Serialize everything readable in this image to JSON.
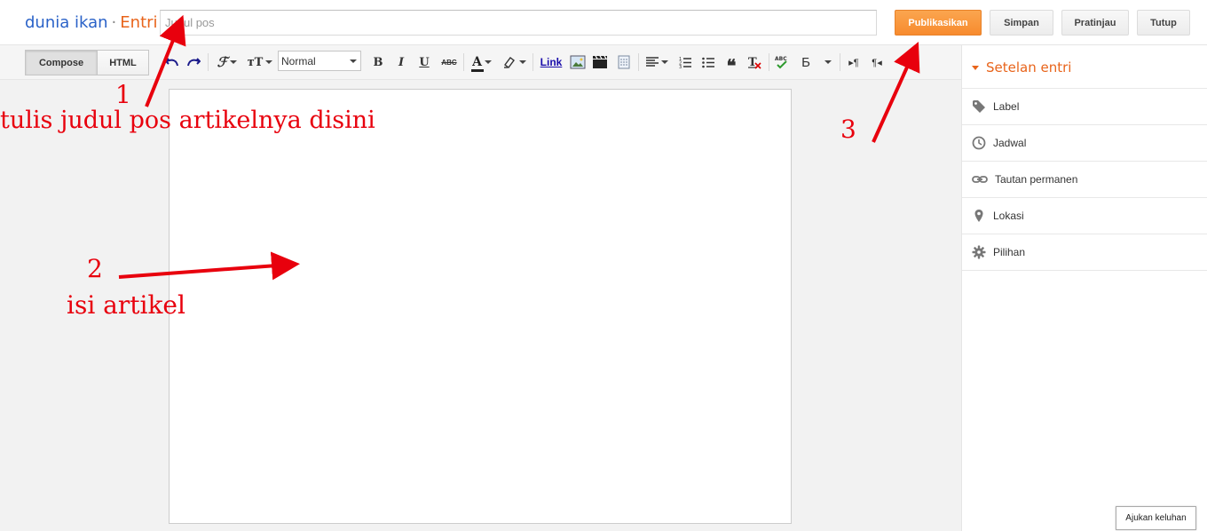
{
  "header": {
    "blog_name": "dunia ikan",
    "separator": "·",
    "section": "Entri",
    "title_placeholder": "Judul pos",
    "buttons": {
      "publish": "Publikasikan",
      "save": "Simpan",
      "preview": "Pratinjau",
      "close": "Tutup"
    }
  },
  "toolbar": {
    "compose": "Compose",
    "html": "HTML",
    "format_select": "Normal",
    "link": "Link",
    "bold": "B",
    "italic": "I",
    "underline": "U",
    "strike": "ABC",
    "cyrillic": "Б"
  },
  "sidebar": {
    "title": "Setelan entri",
    "items": [
      {
        "label": "Label",
        "icon": "tag-icon"
      },
      {
        "label": "Jadwal",
        "icon": "clock-icon"
      },
      {
        "label": "Tautan permanen",
        "icon": "link-icon"
      },
      {
        "label": "Lokasi",
        "icon": "location-pin-icon"
      },
      {
        "label": "Pilihan",
        "icon": "gear-icon"
      }
    ]
  },
  "feedback": "Ajukan keluhan",
  "annotations": {
    "n1": "1",
    "t1": "tulis judul pos artikelnya disini",
    "n2": "2",
    "t2": "isi artikel",
    "n3": "3"
  },
  "colors": {
    "brand_blue": "#2a62c8",
    "accent_orange": "#e8641b",
    "publish_orange": "#f78b2e",
    "annotation_red": "#e8000d"
  }
}
